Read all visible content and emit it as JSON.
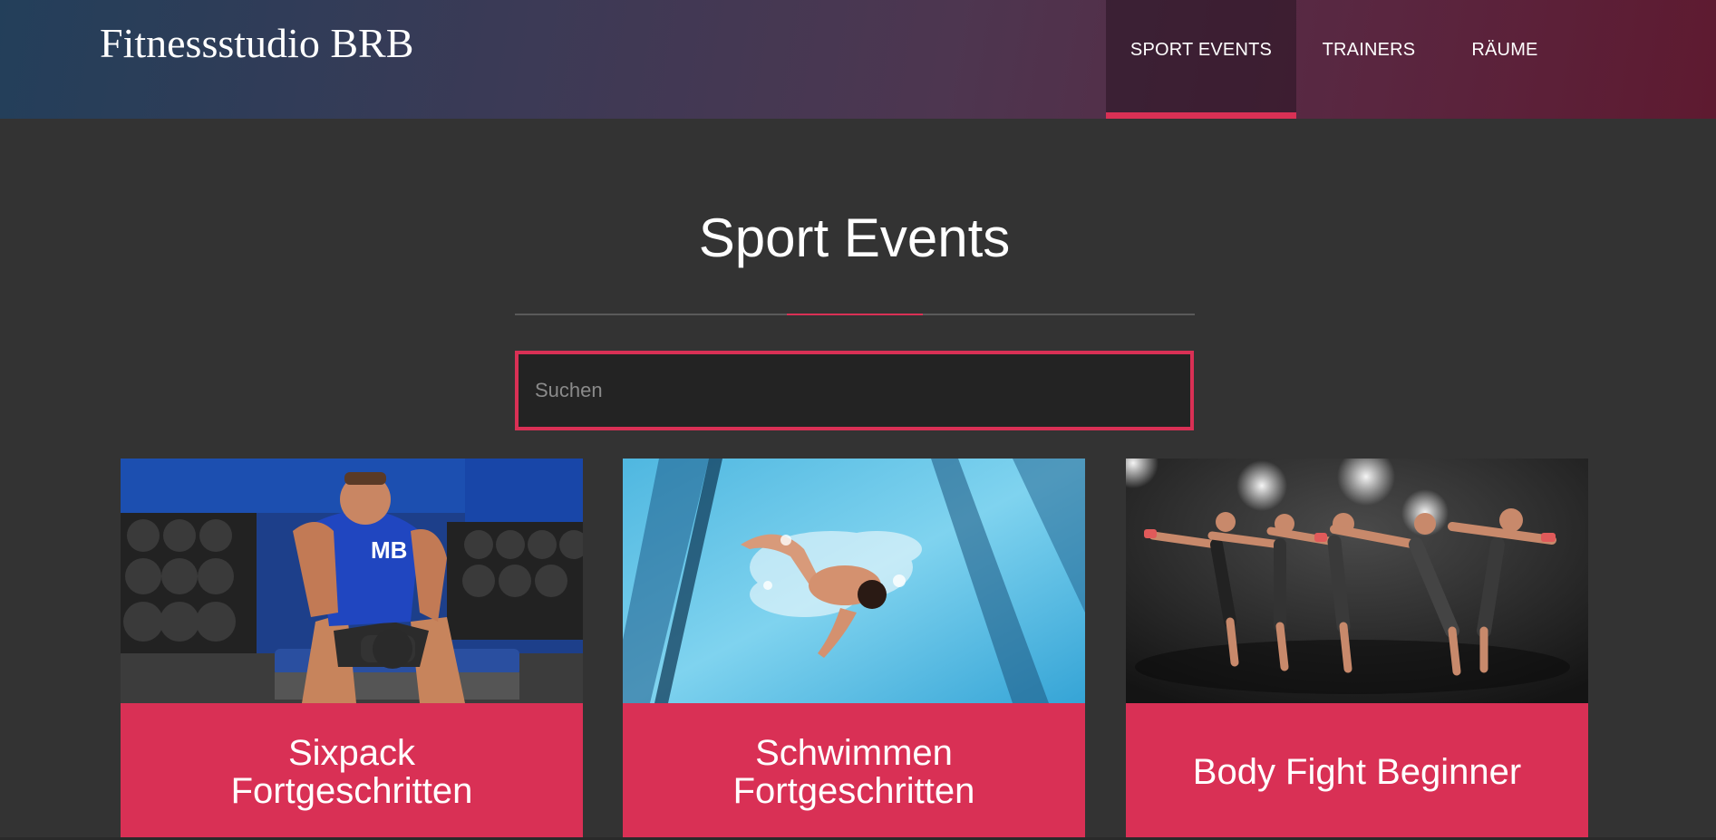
{
  "header": {
    "brand": "Fitnessstudio BRB",
    "nav": [
      {
        "label": "SPORT EVENTS",
        "active": true
      },
      {
        "label": "TRAINERS",
        "active": false
      },
      {
        "label": "RÄUME",
        "active": false
      }
    ]
  },
  "main": {
    "title": "Sport Events",
    "search": {
      "placeholder": "Suchen",
      "value": ""
    },
    "events": [
      {
        "title": "Sixpack\nFortgeschritten",
        "image": "gym-dumbbell-photo"
      },
      {
        "title": "Schwimmen\nFortgeschritten",
        "image": "swimmer-pool-photo"
      },
      {
        "title": "Body Fight Beginner",
        "image": "kickboxing-group-photo"
      }
    ]
  },
  "colors": {
    "accent": "#d93055",
    "background": "#333333"
  }
}
